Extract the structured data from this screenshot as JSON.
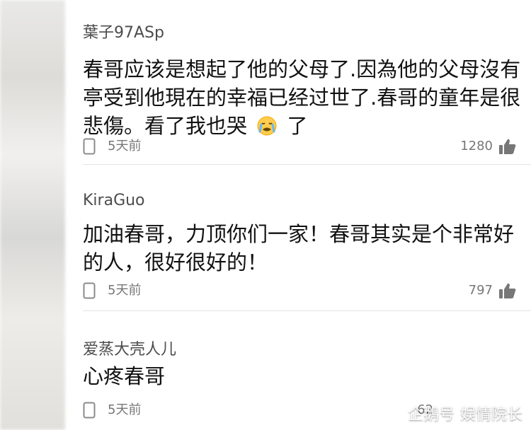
{
  "comments": [
    {
      "username": "葉子97ASp",
      "text_before_emoji": "春哥应该是想起了他的父母了.因為他的父母沒有亭受到他現在的幸福已经过世了.春哥的童年是很悲傷。看了我也哭",
      "emoji_name": "crying-face-icon",
      "text_after_emoji": "了",
      "time": "5天前",
      "likes": "1280"
    },
    {
      "username": "KiraGuo",
      "text": "加油春哥，力顶你们一家！春哥其实是个非常好的人，很好很好的！",
      "time": "5天前",
      "likes": "797"
    },
    {
      "username": "爱蒸大壳人儿",
      "text": "心疼春哥",
      "time": "5天前",
      "likes": "62"
    }
  ],
  "watermark": {
    "platform": "企鹅号",
    "account": "娱情院长"
  },
  "icons": {
    "reply": "reply-icon",
    "like": "thumbs-up-icon",
    "watermark": "penguin-icon"
  },
  "colors": {
    "username": "#4c4c4c",
    "meta": "#777777",
    "divider": "#e4e4e4"
  }
}
